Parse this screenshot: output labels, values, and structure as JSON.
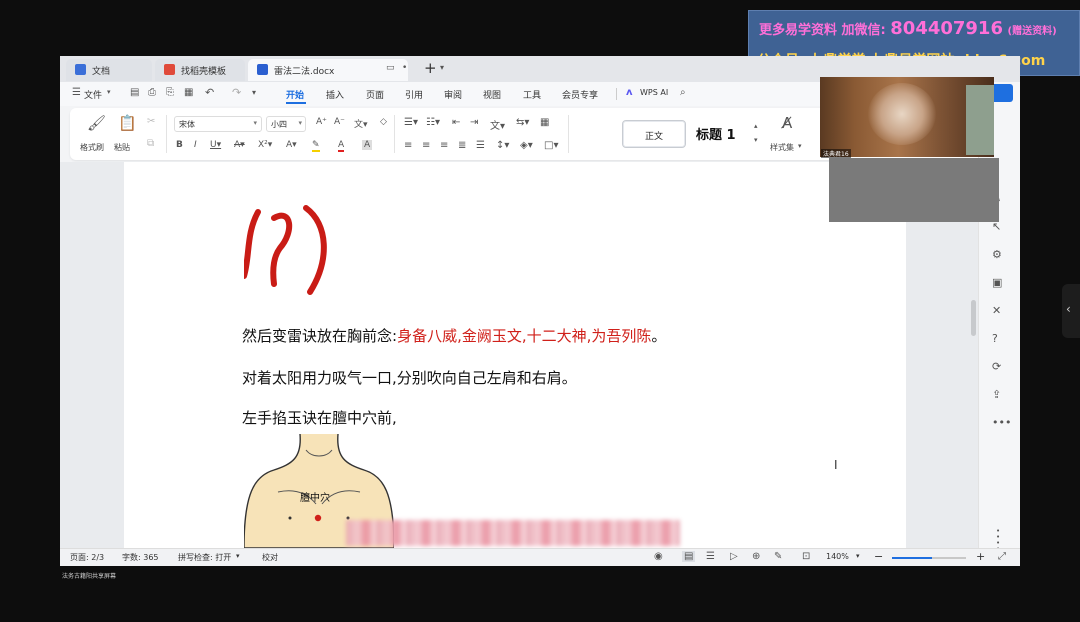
{
  "banner": {
    "line1_prefix": "更多易学资料 加微信:",
    "line1_number": "804407916",
    "line1_suffix": "(赠送资料)",
    "line2": "公众号: 九鼎学堂 九鼎易学网站: jdyx6.com"
  },
  "tabs": [
    {
      "label": "文档",
      "icon": "wps-home-icon",
      "color": "#3b6fd8"
    },
    {
      "label": "找稻壳模板",
      "icon": "docer-icon",
      "color": "#e04a3a"
    },
    {
      "label": "雷法二法.docx",
      "icon": "word-doc-icon",
      "color": "#2b5fd0"
    }
  ],
  "tab_add": "+",
  "menu": {
    "file": "文件",
    "items": [
      "开始",
      "插入",
      "页面",
      "引用",
      "审阅",
      "视图",
      "工具",
      "会员专享"
    ],
    "active": "开始",
    "ai": "WPS AI"
  },
  "ribbon": {
    "format_painter": "格式刷",
    "paste": "粘贴",
    "font_name": "宋体",
    "font_size": "小四",
    "style_normal": "正文",
    "style_heading": "标题 1",
    "style_set": "样式集"
  },
  "document": {
    "para1_black": "然后变雷诀放在胸前念:",
    "para1_red": "身备八威,金阙玉文,十二大神,为吾列陈",
    "para1_end": "。",
    "para2": "对着太阳用力吸气一口,分别吹向自己左肩和右肩。",
    "para3": "左手掐玉诀在膻中穴前,",
    "figure_label": "膻中穴"
  },
  "status": {
    "page": "页面: 2/3",
    "words": "字数: 365",
    "spell": "拼写检查: 打开",
    "proof": "校对",
    "zoom": "140%"
  },
  "video_overlay": {
    "name_tag": "法典君16"
  },
  "footer_caption": "法务古籍阳共享屏幕",
  "colors": {
    "accent": "#1e6fe0",
    "red_text": "#d0201a",
    "banner_bg": "#3f6294",
    "banner_yellow": "#ffd34a",
    "banner_pink": "#ff6fd8"
  }
}
